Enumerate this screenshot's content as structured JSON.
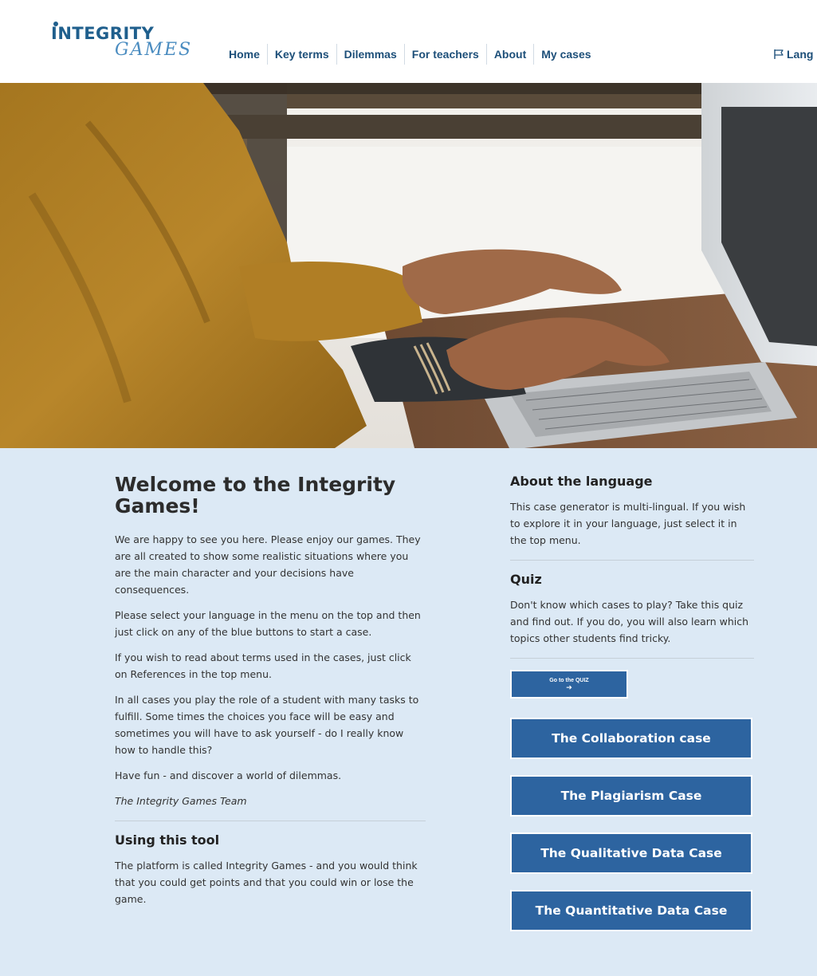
{
  "header": {
    "logo_main": "INTEGRITY",
    "logo_sub": "GAMES",
    "nav": [
      {
        "label": "Home"
      },
      {
        "label": "Key terms"
      },
      {
        "label": "Dilemmas"
      },
      {
        "label": "For teachers"
      },
      {
        "label": "About"
      },
      {
        "label": "My cases"
      }
    ],
    "language_label": "Lang"
  },
  "hero": {
    "icon": "hero-photo-typing-on-laptop"
  },
  "main": {
    "welcome_title": "Welcome to the Integrity Games!",
    "paragraphs": [
      "We are happy to see you here. Please enjoy our games. They are all created to show some realistic situations where you are the main character and your decisions have consequences.",
      "Please select your language in the menu on the top and then just click on any of the blue buttons to start a case.",
      "If you wish to read about terms used in the cases, just click on References in the top menu.",
      "In all cases you play the role of a student with many tasks to fulfill. Some times the choices you face will be easy and sometimes you will have to ask yourself - do I really know how to handle this?",
      "Have fun - and discover a world of dilemmas."
    ],
    "signature": "The Integrity Games Team",
    "using_title": "Using this tool",
    "using_text": "The platform is called Integrity Games - and you would think that you could get points and that you could win or lose the game."
  },
  "sidebar": {
    "about_title": "About the language",
    "about_text": "This case generator is multi-lingual. If you wish to explore it in your language, just select it in the top menu.",
    "quiz_title": "Quiz",
    "quiz_text": "Don't know which cases to play? Take this quiz and find out. If you do, you will also learn which topics other students find tricky.",
    "quiz_button_label": "Go to the QUIZ",
    "quiz_button_arrow": "➔",
    "cases": [
      {
        "label": "The Collaboration case"
      },
      {
        "label": "The Plagiarism Case"
      },
      {
        "label": "The Qualitative Data Case"
      },
      {
        "label": "The Quantitative Data Case"
      }
    ]
  },
  "colors": {
    "nav_text": "#1d4f79",
    "content_bg": "#dce9f5",
    "button_bg": "#2d64a0"
  }
}
